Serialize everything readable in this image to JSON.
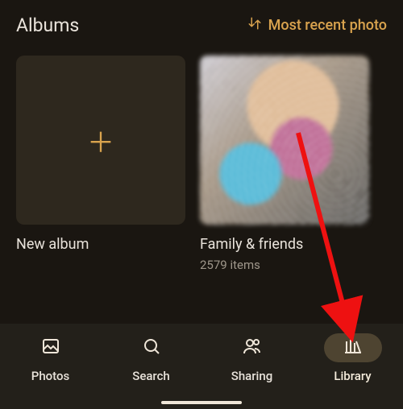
{
  "header": {
    "title": "Albums",
    "sort_label": "Most recent photo"
  },
  "cards": [
    {
      "title": "New album",
      "sub": ""
    },
    {
      "title": "Family & friends",
      "sub": "2579 items"
    }
  ],
  "nav": {
    "items": [
      {
        "label": "Photos"
      },
      {
        "label": "Search"
      },
      {
        "label": "Sharing"
      },
      {
        "label": "Library"
      }
    ],
    "active_index": 3
  },
  "colors": {
    "accent": "#d9a34e",
    "bg": "#1a1611",
    "navbar": "#23201a",
    "nav_pill": "#4e4431"
  },
  "icons": {
    "sort": "swap-vert-icon",
    "new_album": "plus-icon",
    "nav": [
      "image-icon",
      "search-icon",
      "people-icon",
      "library-icon"
    ]
  }
}
